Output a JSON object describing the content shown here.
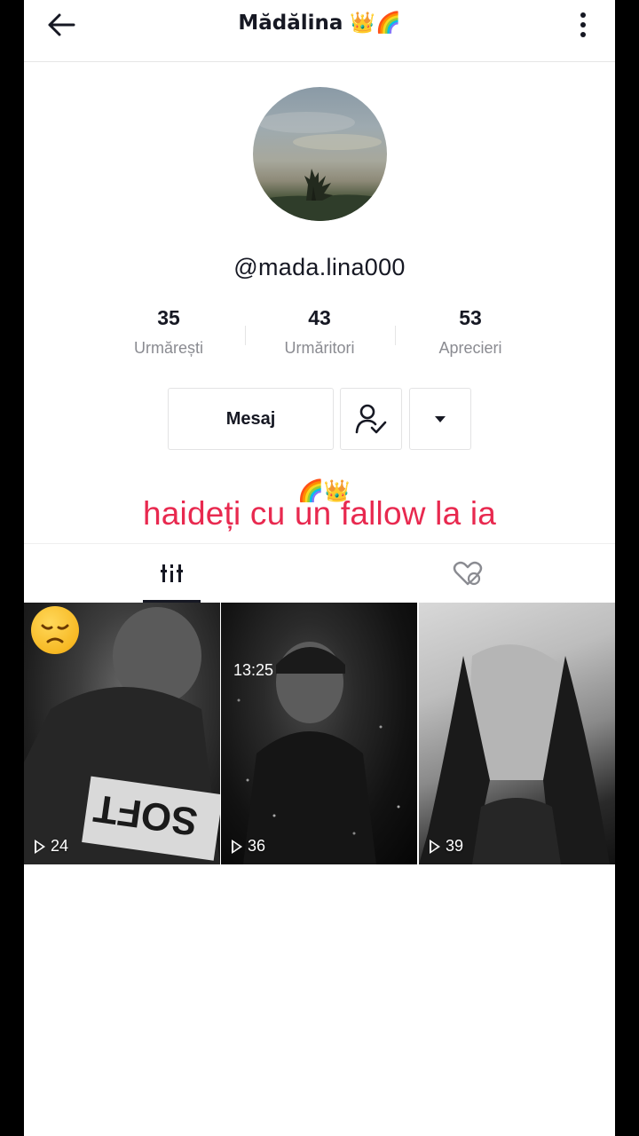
{
  "header": {
    "title": "Mădălina 👑🌈",
    "back_icon": "arrow-left-icon",
    "more_icon": "more-vertical-icon"
  },
  "profile": {
    "username": "@mada.lina000",
    "avatar": "sky-tree-photo"
  },
  "stats": [
    {
      "value": "35",
      "label": "Urmărești"
    },
    {
      "value": "43",
      "label": "Urmăritori"
    },
    {
      "value": "53",
      "label": "Aprecieri"
    }
  ],
  "actions": {
    "message_label": "Mesaj",
    "follow_icon": "user-check-icon",
    "dropdown_icon": "caret-down-icon"
  },
  "bio": {
    "emoji": "🌈👑",
    "text": "haideți cu un fallow la ia"
  },
  "tabs": [
    {
      "icon": "videos-grid-icon",
      "active": true
    },
    {
      "icon": "liked-heart-icon",
      "active": false
    }
  ],
  "videos": [
    {
      "views": "24",
      "overlay_text": ""
    },
    {
      "views": "36",
      "overlay_text": "13:25"
    },
    {
      "views": "39",
      "overlay_text": ""
    }
  ],
  "colors": {
    "bio_text": "#e8294f",
    "primary_text": "#161823",
    "secondary_text": "#8a8b91"
  }
}
